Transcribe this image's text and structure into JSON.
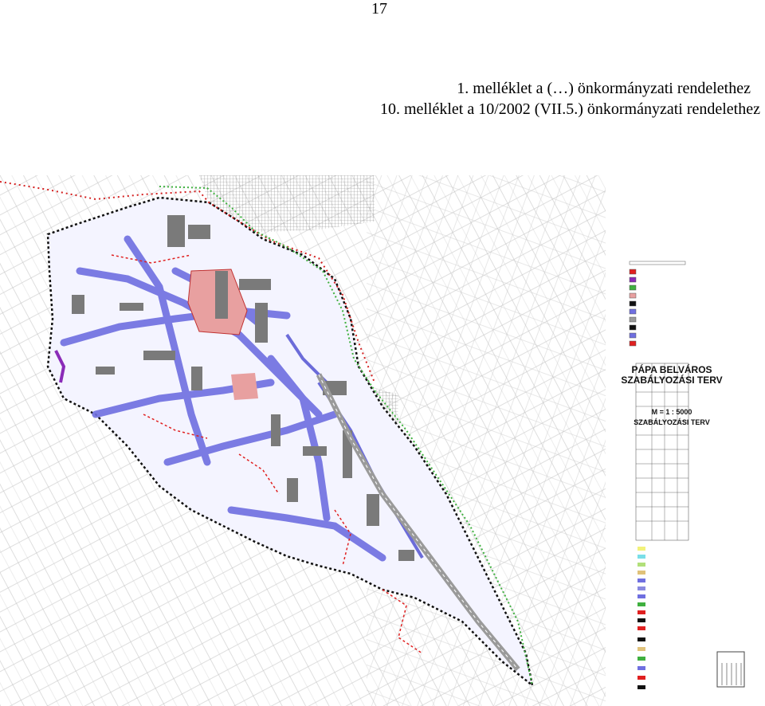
{
  "page_number": "17",
  "header": {
    "line1": "1. melléklet a (…) önkormányzati rendelethez",
    "line2": "10. melléklet a 10/2002 (VII.5.) önkormányzati rendelethez"
  },
  "map": {
    "title_line1": "PÁPA BELVÁROS",
    "title_line2": "SZABÁLYOZÁSI TERV",
    "scale": "M = 1 : 5000",
    "subtitle": "SZABÁLYOZÁSI TERV",
    "colors": {
      "street_fill": "#6f6fe0",
      "building": "#7a7a7a",
      "boundary_red": "#e02020",
      "boundary_black": "#111111",
      "green_line": "#3fb03f",
      "pink_square": "#e8a0a0",
      "hatch": "#9a9a9a"
    }
  }
}
